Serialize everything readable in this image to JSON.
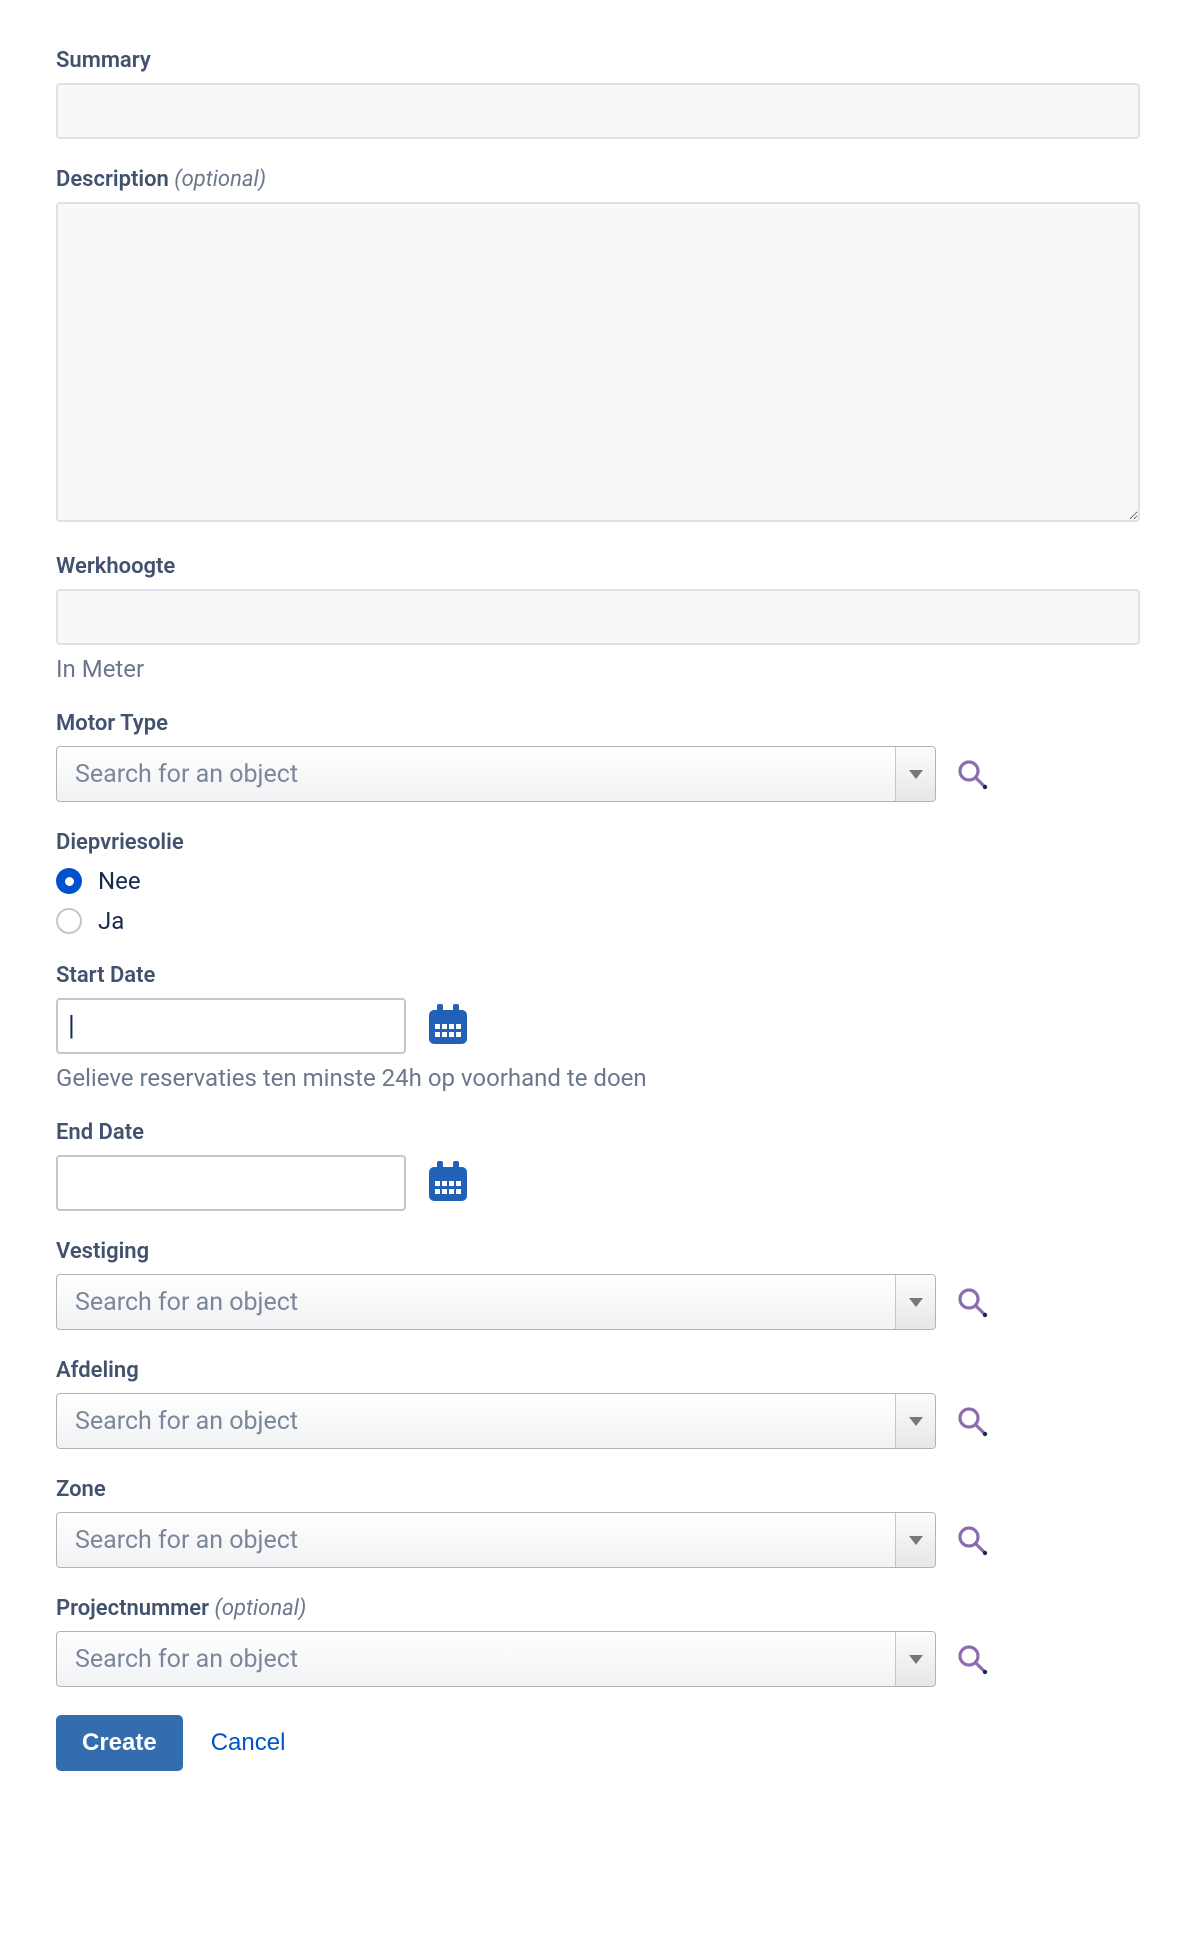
{
  "summary": {
    "label": "Summary",
    "value": ""
  },
  "description": {
    "label": "Description",
    "optional": "(optional)",
    "value": ""
  },
  "werkhoogte": {
    "label": "Werkhoogte",
    "value": "",
    "help": "In Meter"
  },
  "motor_type": {
    "label": "Motor Type",
    "placeholder": "Search for an object"
  },
  "diepvriesolie": {
    "label": "Diepvriesolie",
    "option_nee": "Nee",
    "option_ja": "Ja",
    "selected": "Nee"
  },
  "start_date": {
    "label": "Start Date",
    "value": "",
    "help": "Gelieve reservaties ten minste 24h op voorhand te doen"
  },
  "end_date": {
    "label": "End Date",
    "value": ""
  },
  "vestiging": {
    "label": "Vestiging",
    "placeholder": "Search for an object"
  },
  "afdeling": {
    "label": "Afdeling",
    "placeholder": "Search for an object"
  },
  "zone": {
    "label": "Zone",
    "placeholder": "Search for an object"
  },
  "projectnummer": {
    "label": "Projectnummer",
    "optional": "(optional)",
    "placeholder": "Search for an object"
  },
  "buttons": {
    "create": "Create",
    "cancel": "Cancel"
  },
  "ui": {
    "cursor": "|"
  }
}
